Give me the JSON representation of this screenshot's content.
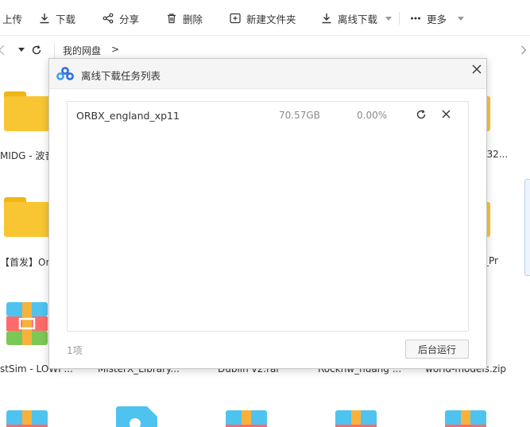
{
  "toolbar": {
    "upload_label": "上传",
    "download_label": "下载",
    "share_label": "分享",
    "delete_label": "删除",
    "new_folder_label": "新建文件夹",
    "offline_download_label": "离线下载",
    "more_label": "更多"
  },
  "nav": {
    "breadcrumb_root": "我的网盘",
    "breadcrumb_sep": ">"
  },
  "files": {
    "row1": [
      "MIDG - 波音",
      "...32..."
    ],
    "row2": [
      "【首发】Orbx",
      "_Pr"
    ],
    "row3": [
      "stSim - LOWI ...",
      "MisterX_Library...",
      "Dublin v2.rar",
      "Rockhw_huang ...",
      "world-models.zip"
    ]
  },
  "dialog": {
    "title": "离线下载任务列表",
    "tasks": [
      {
        "name": "ORBX_england_xp11",
        "size": "70.57GB",
        "progress": "0.00%"
      }
    ],
    "count": "1项",
    "background_button": "后台运行"
  },
  "colors": {
    "folder": "#f9c633",
    "brand_blue": "#2f6fe0"
  }
}
